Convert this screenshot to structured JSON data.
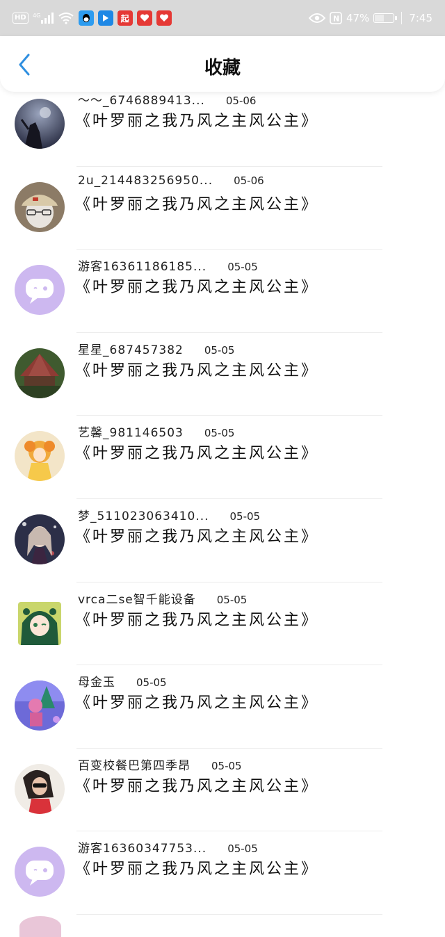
{
  "status_bar": {
    "hd": "HD",
    "signal": "4G",
    "battery": "47%",
    "time": "7:45",
    "app_icons": [
      "qq-icon",
      "app-blue-icon",
      "qidian-icon",
      "heart-app-icon",
      "heart-app-icon"
    ],
    "nfc": "N"
  },
  "header": {
    "title": "收藏",
    "back_icon": "chevron-left-icon"
  },
  "items": [
    {
      "name": "～～_6746889413...",
      "date": "05-06",
      "content": "《叶罗丽之我乃风之主风公主》",
      "avatar": "night-photo"
    },
    {
      "name": "2u_214483256950...",
      "date": "05-06",
      "content": "《叶罗丽之我乃风之主风公主》",
      "avatar": "cap-person"
    },
    {
      "name": "游客16361186185...",
      "date": "05-05",
      "content": "《叶罗丽之我乃风之主风公主》",
      "avatar": "default-chat"
    },
    {
      "name": "星星_687457382",
      "date": "05-05",
      "content": "《叶罗丽之我乃风之主风公主》",
      "avatar": "pavilion"
    },
    {
      "name": "艺馨_981146503",
      "date": "05-05",
      "content": "《叶罗丽之我乃风之主风公主》",
      "avatar": "anime-yellow"
    },
    {
      "name": "梦_511023063410...",
      "date": "05-05",
      "content": "《叶罗丽之我乃风之主风公主》",
      "avatar": "anime-dark"
    },
    {
      "name": "vrca二se智千能设备",
      "date": "05-05",
      "content": "《叶罗丽之我乃风之主风公主》",
      "avatar": "anime-green"
    },
    {
      "name": "母金玉",
      "date": "05-05",
      "content": "《叶罗丽之我乃风之主风公主》",
      "avatar": "blue-figure"
    },
    {
      "name": "百变校餐巴第四季昂",
      "date": "05-05",
      "content": "《叶罗丽之我乃风之主风公主》",
      "avatar": "girl-red"
    },
    {
      "name": "游客16360347753...",
      "date": "05-05",
      "content": "《叶罗丽之我乃风之主风公主》",
      "avatar": "default-chat"
    }
  ],
  "colors": {
    "accent": "#2f8fe0",
    "default_avatar_bg": "#cdb8f0",
    "status_bar_bg": "#d9d9d9"
  }
}
